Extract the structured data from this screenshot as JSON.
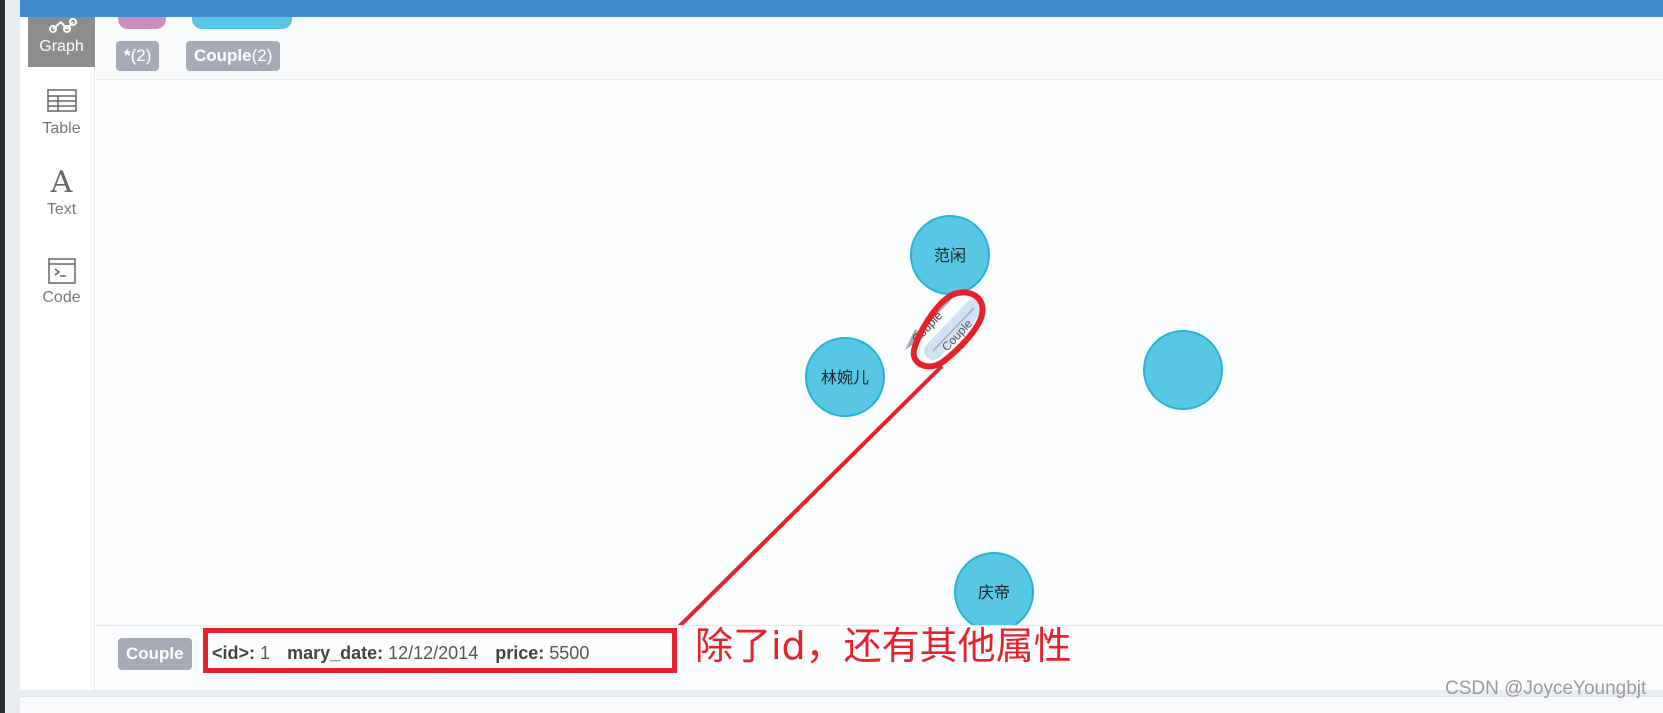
{
  "sidebar": {
    "items": [
      {
        "label": "Graph",
        "icon": "graph-icon",
        "active": true
      },
      {
        "label": "Table",
        "icon": "table-icon",
        "active": false
      },
      {
        "label": "Text",
        "icon": "text-icon",
        "active": false
      },
      {
        "label": "Code",
        "icon": "code-icon",
        "active": false
      }
    ]
  },
  "legend": {
    "all": {
      "label": "*",
      "count": "(2)"
    },
    "couple": {
      "label": "Couple",
      "count": "(2)"
    }
  },
  "graph": {
    "nodes": [
      {
        "label": "范闲"
      },
      {
        "label": "林婉儿"
      },
      {
        "label": ""
      },
      {
        "label": "庆帝"
      }
    ],
    "edges": [
      {
        "label": "Couple"
      },
      {
        "label": "Couple"
      }
    ]
  },
  "inspector": {
    "tag": "Couple",
    "props": [
      {
        "key": "<id>:",
        "value": "1"
      },
      {
        "key": "mary_date:",
        "value": "12/12/2014"
      },
      {
        "key": "price:",
        "value": "5500"
      }
    ]
  },
  "annotation": {
    "text": "除了id，还有其他属性"
  },
  "watermark": "CSDN @JoyceYoungbjt",
  "colors": {
    "node_fill": "#57c7e3",
    "node_stroke": "#23b3d7",
    "top_bar": "#428bca",
    "annotation": "#e62129",
    "pill": "#a5abb6"
  }
}
